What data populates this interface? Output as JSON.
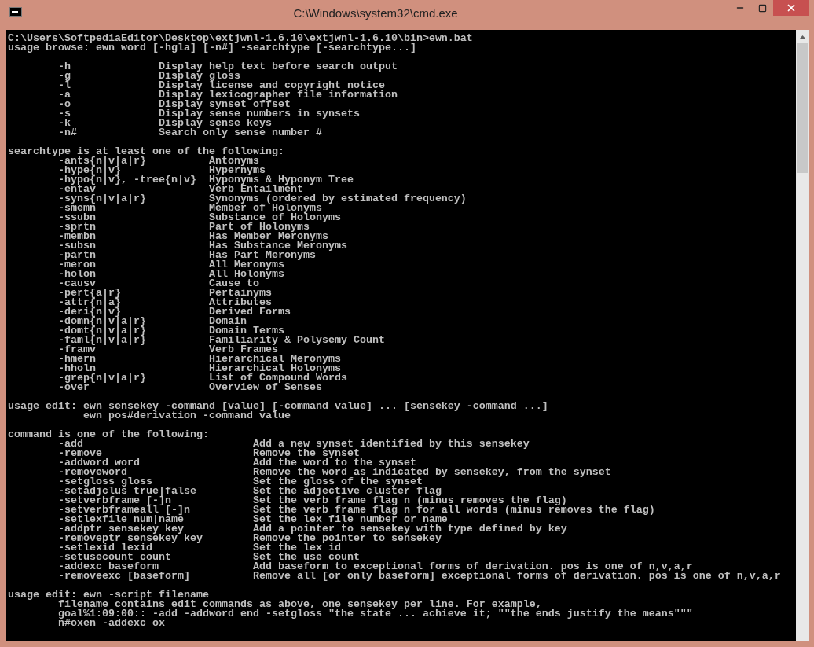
{
  "window": {
    "title": "C:\\Windows\\system32\\cmd.exe"
  },
  "console": {
    "blocks": [
      [
        "C:\\Users\\SoftpediaEditor\\Desktop\\extjwnl-1.6.10\\extjwnl-1.6.10\\bin>ewn.bat",
        "usage browse: ewn word [-hgla] [-n#] -searchtype [-searchtype...]"
      ],
      [
        "        -h              Display help text before search output",
        "        -g              Display gloss",
        "        -l              Display license and copyright notice",
        "        -a              Display lexicographer file information",
        "        -o              Display synset offset",
        "        -s              Display sense numbers in synsets",
        "        -k              Display sense keys",
        "        -n#             Search only sense number #"
      ],
      [
        "searchtype is at least one of the following:",
        "        -ants{n|v|a|r}          Antonyms",
        "        -hype{n|v}              Hypernyms",
        "        -hypo{n|v}, -tree{n|v}  Hyponyms & Hyponym Tree",
        "        -entav                  Verb Entailment",
        "        -syns{n|v|a|r}          Synonyms (ordered by estimated frequency)",
        "        -smemn                  Member of Holonyms",
        "        -ssubn                  Substance of Holonyms",
        "        -sprtn                  Part of Holonyms",
        "        -membn                  Has Member Meronyms",
        "        -subsn                  Has Substance Meronyms",
        "        -partn                  Has Part Meronyms",
        "        -meron                  All Meronyms",
        "        -holon                  All Holonyms",
        "        -causv                  Cause to",
        "        -pert{a|r}              Pertainyms",
        "        -attr{n|a}              Attributes",
        "        -deri{n|v}              Derived Forms",
        "        -domn{n|v|a|r}          Domain",
        "        -domt{n|v|a|r}          Domain Terms",
        "        -faml{n|v|a|r}          Familiarity & Polysemy Count",
        "        -framv                  Verb Frames",
        "        -hmern                  Hierarchical Meronyms",
        "        -hholn                  Hierarchical Holonyms",
        "        -grep{n|v|a|r}          List of Compound Words",
        "        -over                   Overview of Senses"
      ],
      [
        "usage edit: ewn sensekey -command [value] [-command value] ... [sensekey -command ...]",
        "            ewn pos#derivation -command value"
      ],
      [
        "command is one of the following:",
        "        -add                           Add a new synset identified by this sensekey",
        "        -remove                        Remove the synset",
        "        -addword word                  Add the word to the synset",
        "        -removeword                    Remove the word as indicated by sensekey, from the synset",
        "        -setgloss gloss                Set the gloss of the synset",
        "        -setadjclus true|false         Set the adjective cluster flag",
        "        -setverbframe [-]n             Set the verb frame flag n (minus removes the flag)",
        "        -setverbframeall [-]n          Set the verb frame flag n for all words (minus removes the flag)",
        "        -setlexfile num|name           Set the lex file number or name",
        "        -addptr sensekey key           Add a pointer to sensekey with type defined by key",
        "        -removeptr sensekey key        Remove the pointer to sensekey",
        "        -setlexid lexid                Set the lex id",
        "        -setusecount count             Set the use count",
        "        -addexc baseform               Add baseform to exceptional forms of derivation. pos is one of n,v,a,r",
        "        -removeexc [baseform]          Remove all [or only baseform] exceptional forms of derivation. pos is one of n,v,a,r"
      ],
      [
        "usage edit: ewn -script filename",
        "        filename contains edit commands as above, one sensekey per line. For example,",
        "        goal%1:09:00:: -add -addword end -setgloss \"the state ... achieve it; \"\"the ends justify the means\"\"\"",
        "        n#oxen -addexc ox"
      ]
    ]
  }
}
